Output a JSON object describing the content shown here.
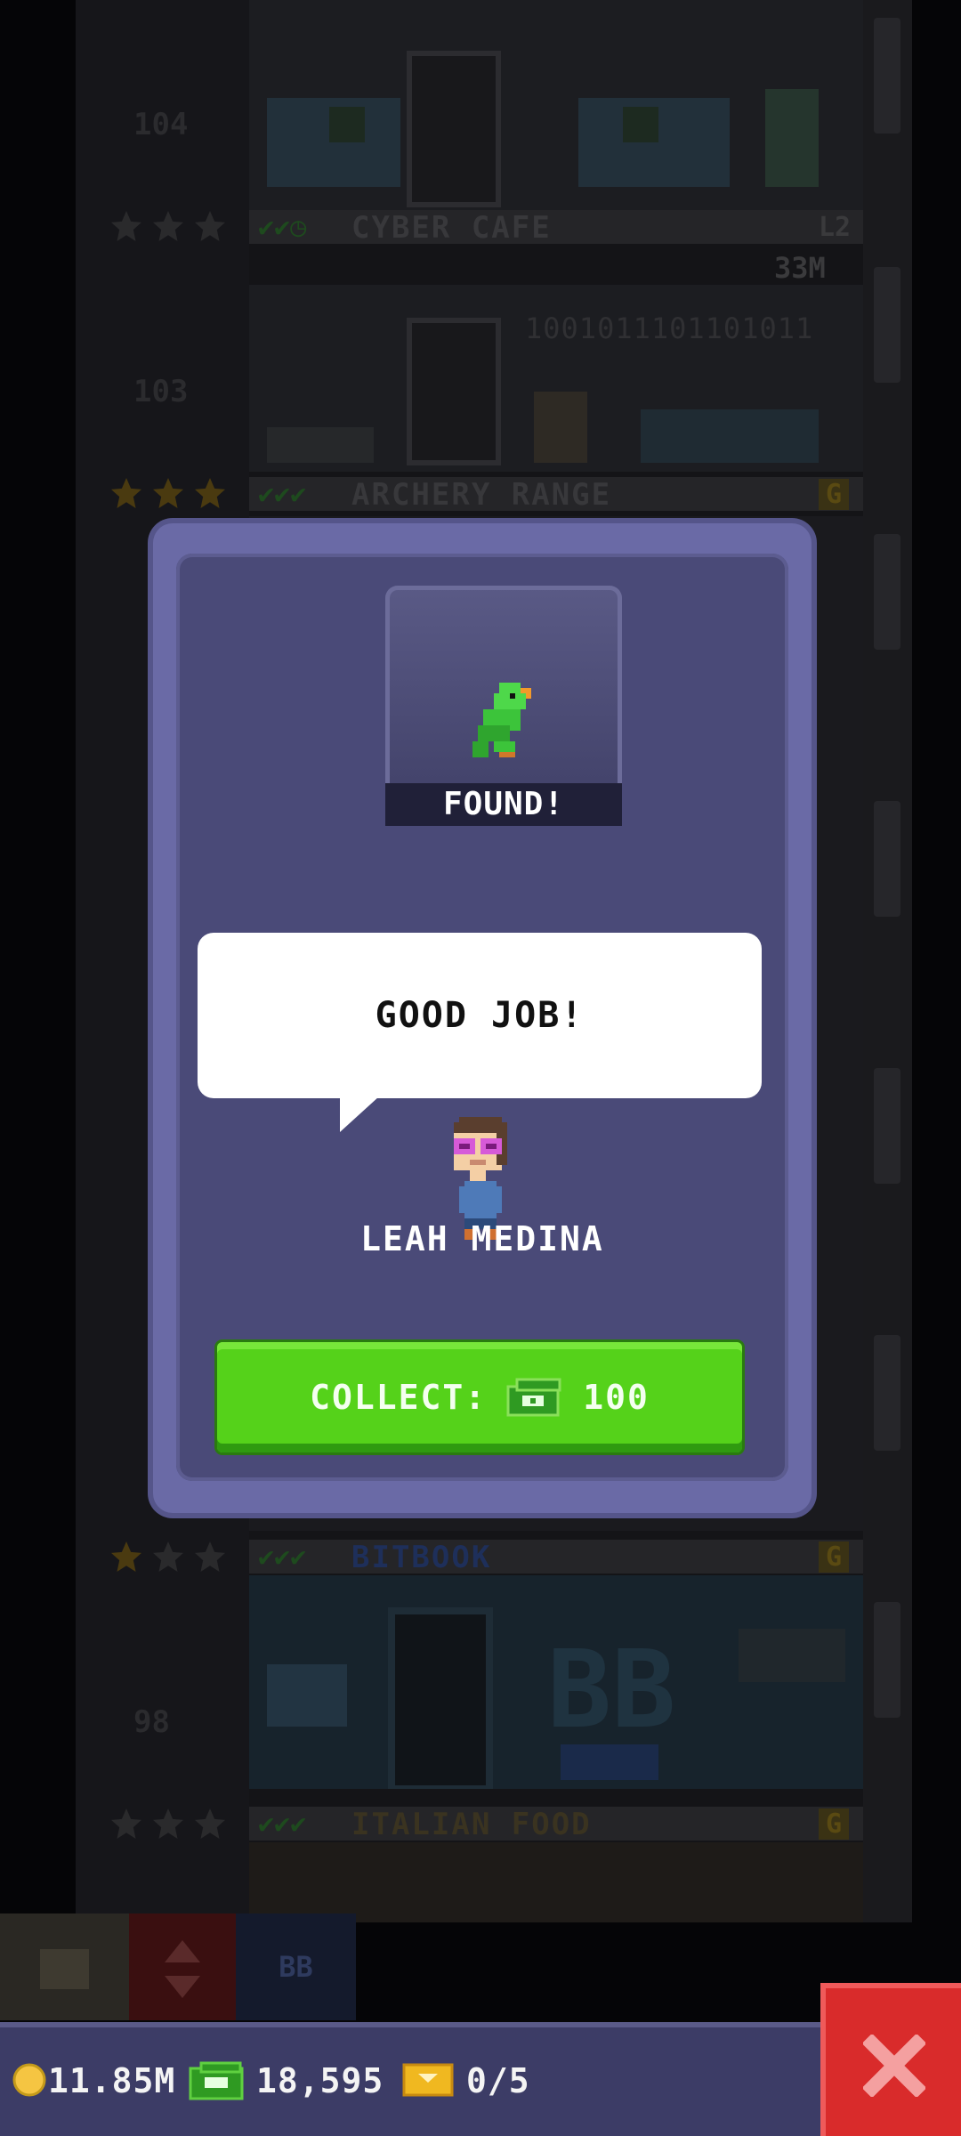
{
  "tower": {
    "floors": [
      {
        "number": "104",
        "name": "CYBER CAFE",
        "level": "L2",
        "price": "33M"
      },
      {
        "number": "103",
        "name": "ARCHERY RANGE",
        "level": "G",
        "binary": "1001011101101011"
      },
      {
        "number": "",
        "name": "BITBOOK",
        "level": "G",
        "sign": "BB"
      },
      {
        "number": "98",
        "name": "ITALIAN FOOD",
        "level": "G"
      }
    ]
  },
  "modal": {
    "found_label": "FOUND!",
    "item_icon": "green-parrot-icon",
    "message": "GOOD JOB!",
    "npc_name": "LEAH MEDINA",
    "collect_label": "COLLECT:",
    "collect_amount": "100",
    "collect_icon": "bux-cash-icon"
  },
  "toolbar": {
    "elevator_icon": "elevator-arrows-icon",
    "bitbook_label": "BB"
  },
  "currency": {
    "coins": "11.85M",
    "bux": "18,595",
    "tickets": "0/5"
  },
  "close_icon": "close-x-icon",
  "colors": {
    "modal_bg": "#4a4a78",
    "modal_frame": "#6a6aa6",
    "collect_green": "#55d21a",
    "close_red": "#d92b2b",
    "bar_bg": "#3c3c66"
  }
}
